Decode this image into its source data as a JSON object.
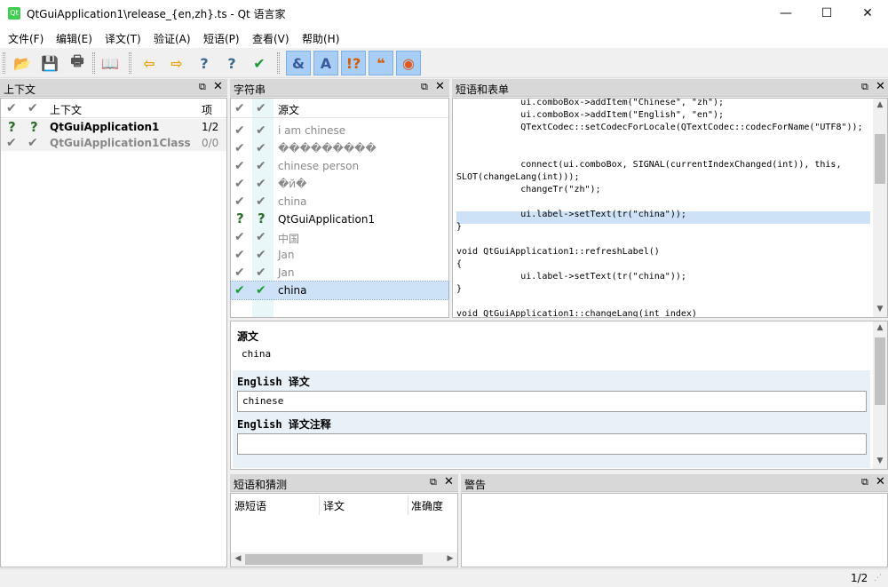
{
  "window": {
    "title": "QtGuiApplication1\\release_{en,zh}.ts - Qt 语言家",
    "icon_text": "Qt",
    "minimize": "—",
    "maximize": "☐",
    "close": "✕"
  },
  "menu": [
    "文件(F)",
    "编辑(E)",
    "译文(T)",
    "验证(A)",
    "短语(P)",
    "查看(V)",
    "帮助(H)"
  ],
  "toolbar": {
    "icons": [
      "open-icon",
      "save-icon",
      "print-icon",
      "phrasebook-icon",
      "prev-icon",
      "next-icon",
      "prev-unfinished-icon",
      "next-unfinished-icon",
      "done-next-icon",
      "accelerator-check-icon",
      "punctuation-check-icon",
      "phrase-check-icon",
      "placemarker-check-icon",
      "surrounding-whitespace-icon"
    ],
    "glyphs": [
      "📂",
      "💾",
      "🖶",
      "📖",
      "⇦",
      "⇨",
      "?",
      "?",
      "✔",
      "&",
      "A",
      "!?",
      "❝",
      "◉"
    ],
    "highlighted_from": 9
  },
  "context_dock": {
    "title": "上下文",
    "float_icon": "⧉",
    "close_icon": "✕",
    "col_context": "上下文",
    "col_items": "项",
    "rows": [
      {
        "status": "?",
        "name": "QtGuiApplication1",
        "count": "1/2"
      },
      {
        "status": "✔",
        "name": "QtGuiApplication1Class",
        "count": "0/0"
      }
    ]
  },
  "strings_dock": {
    "title": "字符串",
    "col_source": "源文",
    "rows": [
      {
        "status": "✔",
        "text": "i am chinese"
      },
      {
        "status": "✔",
        "text": "���������"
      },
      {
        "status": "✔",
        "text": "chinese person"
      },
      {
        "status": "✔",
        "text": "�й�"
      },
      {
        "status": "✔",
        "text": "china"
      },
      {
        "status": "?",
        "text": "QtGuiApplication1"
      },
      {
        "status": "✔",
        "text": "中国"
      },
      {
        "status": "✔",
        "text": "Jan"
      },
      {
        "status": "✔",
        "text": "Jan"
      },
      {
        "status": "✔",
        "text": "china"
      }
    ]
  },
  "phrases_dock": {
    "title": "短语和表单",
    "lines": [
      "            ui.comboBox->addItem(\"Chinese\", \"zh\");",
      "            ui.comboBox->addItem(\"English\", \"en\");",
      "            QTextCodec::setCodecForLocale(QTextCodec::codecForName(\"UTF8\"));",
      "",
      "",
      "            connect(ui.comboBox, SIGNAL(currentIndexChanged(int)), this,",
      "SLOT(changeLang(int)));",
      "            changeTr(\"zh\");",
      "",
      "            ui.label->setText(tr(\"china\"));",
      "}",
      "",
      "void QtGuiApplication1::refreshLabel()",
      "{",
      "            ui.label->setText(tr(\"china\"));",
      "}",
      "",
      "void QtGuiApplication1::changeLang(int index)"
    ]
  },
  "editor": {
    "source_label": "源文",
    "source_text": "china",
    "translation_label": "English 译文",
    "translation_value": "chinese",
    "comment_label": "English 译文注释",
    "comment_value": ""
  },
  "guess_dock": {
    "title": "短语和猜测",
    "col_source": "源短语",
    "col_translation": "译文",
    "col_accuracy": "准确度"
  },
  "warnings_dock": {
    "title": "警告"
  },
  "status": {
    "progress": "1/2"
  },
  "colors": {
    "selection": "#cde2f7",
    "toolbar_highlight": "#a9cef6",
    "done_green": "#1b9a35"
  }
}
